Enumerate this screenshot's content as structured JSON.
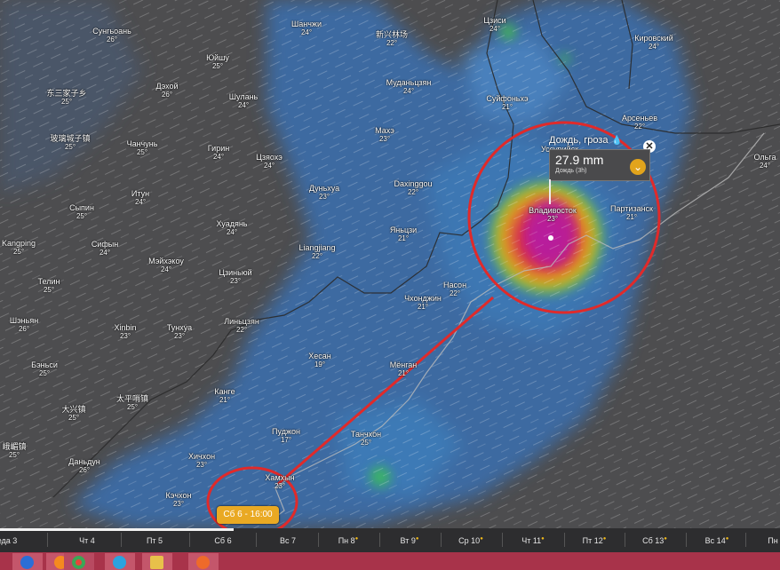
{
  "cities": [
    {
      "name": "Сунгьоань",
      "temp": "26°"
    },
    {
      "name": "Шанчжи",
      "temp": "24°"
    },
    {
      "name": "新兴林场",
      "temp": "22°"
    },
    {
      "name": "Цзиси",
      "temp": "24°"
    },
    {
      "name": "Кировский",
      "temp": "24°"
    },
    {
      "name": "Юйшу",
      "temp": "25°"
    },
    {
      "name": "Дэхой",
      "temp": "26°"
    },
    {
      "name": "Муданьцзян",
      "temp": "24°"
    },
    {
      "name": "Шулань",
      "temp": "24°"
    },
    {
      "name": "东三家子乡",
      "temp": "25°"
    },
    {
      "name": "Суйфоньхэ",
      "temp": "21°"
    },
    {
      "name": "Арсеньев",
      "temp": "22°"
    },
    {
      "name": "Махэ",
      "temp": "23°"
    },
    {
      "name": "玻璃城子镇",
      "temp": "25°"
    },
    {
      "name": "Чанчунь",
      "temp": "25°"
    },
    {
      "name": "Гирин",
      "temp": "24°"
    },
    {
      "name": "Цзяохэ",
      "temp": "24°"
    },
    {
      "name": "Уссурийск",
      "temp": ""
    },
    {
      "name": "Ольга",
      "temp": "24°"
    },
    {
      "name": "Дуньхуа",
      "temp": "23°"
    },
    {
      "name": "Daxinggou",
      "temp": "22°"
    },
    {
      "name": "Сыпин",
      "temp": "25°"
    },
    {
      "name": "Итун",
      "temp": "24°"
    },
    {
      "name": "Владивосток",
      "temp": "23°"
    },
    {
      "name": "Партизанск",
      "temp": "21°"
    },
    {
      "name": "Хуадянь",
      "temp": "24°"
    },
    {
      "name": "Яньцзи",
      "temp": "21°"
    },
    {
      "name": "Kangping",
      "temp": "25°"
    },
    {
      "name": "Сифын",
      "temp": "24°"
    },
    {
      "name": "Liangjiang",
      "temp": "22°"
    },
    {
      "name": "Мэйхэкоу",
      "temp": "24°"
    },
    {
      "name": "Цзиньюй",
      "temp": "23°"
    },
    {
      "name": "Телин",
      "temp": "25°"
    },
    {
      "name": "Насон",
      "temp": "22°"
    },
    {
      "name": "Чхонджин",
      "temp": "21°"
    },
    {
      "name": "Шэньян",
      "temp": "26°"
    },
    {
      "name": "Xinbin",
      "temp": "23°"
    },
    {
      "name": "Тунхуа",
      "temp": "23°"
    },
    {
      "name": "Линьцзян",
      "temp": "22°"
    },
    {
      "name": "Хесан",
      "temp": "19°"
    },
    {
      "name": "Бэньси",
      "temp": "25°"
    },
    {
      "name": "Мёнган",
      "temp": "21°"
    },
    {
      "name": "Канге",
      "temp": "21°"
    },
    {
      "name": "太平哨镇",
      "temp": "25°"
    },
    {
      "name": "大兴镇",
      "temp": "25°"
    },
    {
      "name": "Пуджон",
      "temp": "17°"
    },
    {
      "name": "Танчхон",
      "temp": "25°"
    },
    {
      "name": "Хичхон",
      "temp": "23°"
    },
    {
      "name": "峨嵋镇",
      "temp": "25°"
    },
    {
      "name": "Даньдун",
      "temp": "26°"
    },
    {
      "name": "Кэчхон",
      "temp": "23°"
    },
    {
      "name": "Хамхын",
      "temp": "23°"
    }
  ],
  "popup": {
    "title": "Дождь, гроза",
    "value": "27.9 mm",
    "subtitle": "Дождь (3h)",
    "expand_icon": "chevron-down-icon",
    "close_icon": "close-icon",
    "drop_icon": "raindrop-icon"
  },
  "time_label": "Сб 6 - 16:00",
  "timeline": {
    "days": [
      "еда 3",
      "Чт 4",
      "Пт 5",
      "Сб 6",
      "Вс 7",
      "Пн 8",
      "Вт 9",
      "Ср 10",
      "Чт 11",
      "Пт 12",
      "Сб 13",
      "Вс 14",
      "Пн"
    ],
    "sun_marked": [
      false,
      false,
      false,
      false,
      false,
      true,
      true,
      true,
      true,
      true,
      true,
      true,
      false
    ],
    "progress_fraction": 0.3
  },
  "colors": {
    "land": "#4d4d4f",
    "rain_light": "#3b73b8",
    "rain_heavy": "#b5208f",
    "annotation": "#e02a2a",
    "accent": "#e9a923",
    "taskbar": "#a8334a"
  },
  "taskbar_icons": [
    "browser-icon",
    "firefox-icon",
    "chrome-icon",
    "telegram-icon",
    "folder-icon",
    "media-icon"
  ]
}
